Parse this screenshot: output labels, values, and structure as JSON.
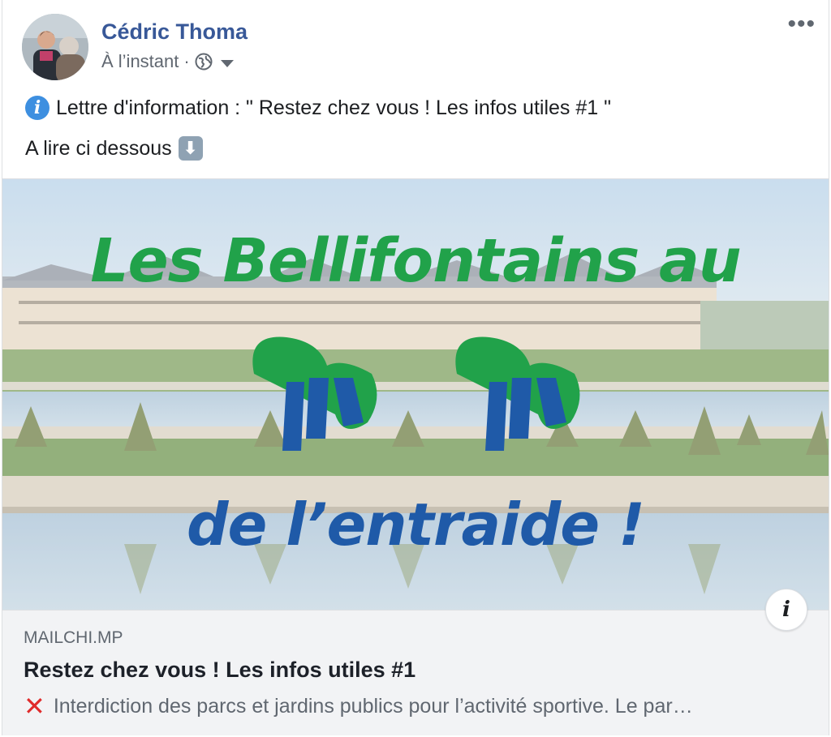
{
  "author": {
    "name": "Cédric Thoma",
    "timestamp": "À l’instant",
    "separator": "·",
    "privacy_icon": "globe-icon"
  },
  "post": {
    "line1_icon": "information-emoji",
    "line1": "Lettre d'information : \" Restez chez vous ! Les infos utiles #1 \"",
    "line2": "A lire ci dessous",
    "line2_icon": "down-arrow-emoji"
  },
  "image": {
    "headline_top": "Les Bellifontains au",
    "headline_bottom": "de l’entraide !",
    "colors": {
      "green": "#21a24a",
      "blue": "#1f5aa8"
    }
  },
  "link_preview": {
    "domain": "MAILCHI.MP",
    "title": "Restez chez vous ! Les infos utiles #1",
    "description_icon": "red-cross-emoji",
    "description": "Interdiction des parcs et jardins publics pour l’activité sportive. Le par…"
  },
  "colors": {
    "link": "#385898",
    "meta": "#606770",
    "preview_bg": "#f2f3f5"
  }
}
